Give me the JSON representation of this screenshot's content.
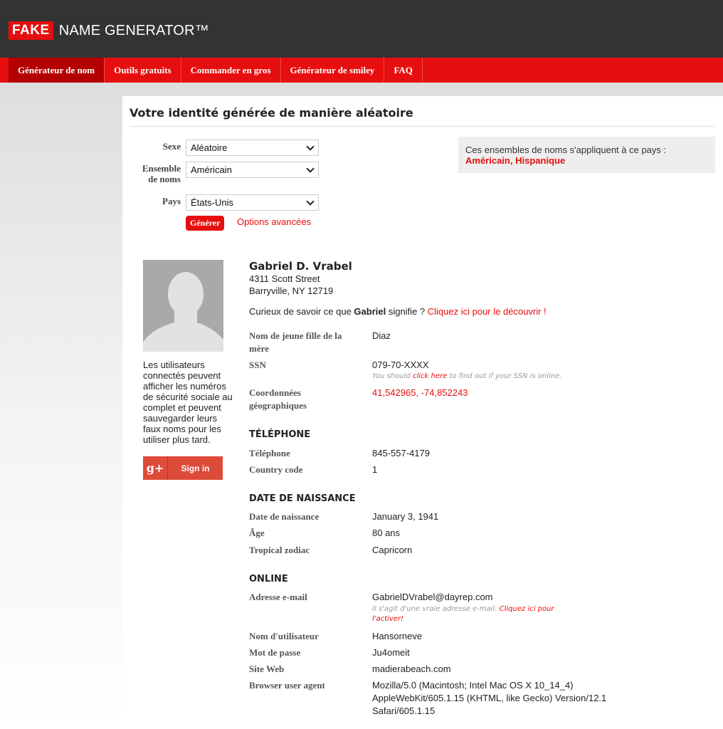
{
  "header": {
    "logo_fake": "FAKE",
    "logo_rest": "NAME GENERATOR™"
  },
  "nav": [
    {
      "label": "Générateur de nom",
      "active": true
    },
    {
      "label": "Outils gratuits",
      "active": false
    },
    {
      "label": "Commander en gros",
      "active": false
    },
    {
      "label": "Générateur de smiley",
      "active": false
    },
    {
      "label": "FAQ",
      "active": false
    }
  ],
  "page": {
    "title": "Votre identité générée de manière aléatoire"
  },
  "form": {
    "sexe_label": "Sexe",
    "sexe_value": "Aléatoire",
    "nameset_label_1": "Ensemble",
    "nameset_label_2": "de noms",
    "nameset_value": "Américain",
    "pays_label": "Pays",
    "pays_value": "États-Unis",
    "generate_label": "Générer",
    "advanced_label": "Options avancées"
  },
  "info": {
    "text": "Ces ensembles de noms s'appliquent à ce pays :",
    "country_1": "Américain",
    "separator": ", ",
    "country_2": "Hispanique"
  },
  "sidebar": {
    "note": "Les utilisateurs connectés peuvent afficher les numéros de sécurité sociale au complet et peuvent sauvegarder leurs faux noms pour les utiliser plus tard.",
    "gplus_icon": "g+",
    "signin_label": "Sign in"
  },
  "identity": {
    "name": "Gabriel D. Vrabel",
    "street": "4311 Scott Street",
    "city": "Barryville, NY 12719",
    "curious_pre": "Curieux de savoir ce que ",
    "curious_name": "Gabriel",
    "curious_mid": " signifie ? ",
    "curious_link": "Cliquez ici pour le découvrir !"
  },
  "details": {
    "maiden_label_1": "Nom de jeune fille de la",
    "maiden_label_2": "mère",
    "maiden_value": "Diaz",
    "ssn_label": "SSN",
    "ssn_value": "079-70-XXXX",
    "ssn_note_pre": "You should ",
    "ssn_note_link": "click here",
    "ssn_note_post": " to find out if your SSN is online.",
    "geo_label_1": "Coordonnées",
    "geo_label_2": "géographiques",
    "geo_value": "41,542965, -74,852243"
  },
  "phone": {
    "heading": "TÉLÉPHONE",
    "phone_label": "Téléphone",
    "phone_value": "845-557-4179",
    "cc_label": "Country code",
    "cc_value": "1"
  },
  "birthday": {
    "heading": "DATE DE NAISSANCE",
    "dob_label": "Date de naissance",
    "dob_value": "January 3, 1941",
    "age_label": "Âge",
    "age_value": "80 ans",
    "zodiac_label": "Tropical zodiac",
    "zodiac_value": "Capricorn"
  },
  "online": {
    "heading": "ONLINE",
    "email_label": "Adresse e-mail",
    "email_value": "GabrielDVrabel@dayrep.com",
    "email_note_pre": "Il s'agit d'une vraie adresse e-mail. ",
    "email_note_link_1": "Cliquez ici pour",
    "email_note_link_2": "l'activer!",
    "username_label": "Nom d'utilisateur",
    "username_value": "Hansorneve",
    "password_label": "Mot de passe",
    "password_value": "Ju4omeit",
    "website_label": "Site Web",
    "website_value": "madierabeach.com",
    "ua_label": "Browser user agent",
    "ua_line_1": "Mozilla/5.0 (Macintosh; Intel Mac OS X 10_14_4)",
    "ua_line_2": "AppleWebKit/605.1.15 (KHTML, like Gecko) Version/12.1",
    "ua_line_3": "Safari/605.1.15"
  }
}
